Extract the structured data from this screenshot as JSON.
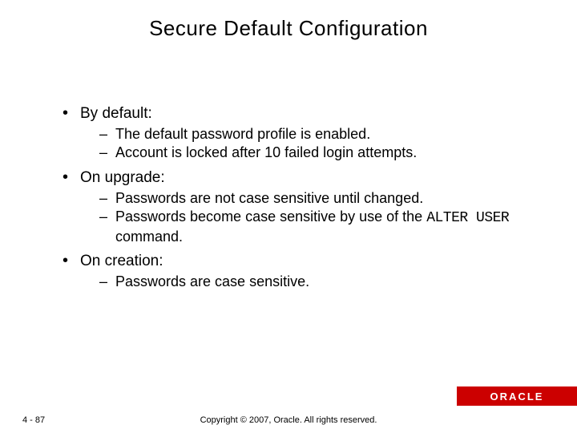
{
  "title": "Secure Default Configuration",
  "sections": [
    {
      "heading": "By default:",
      "items": [
        "The default password profile is enabled.",
        "Account is locked after 10 failed login attempts."
      ]
    },
    {
      "heading": "On upgrade:",
      "items": [
        "Passwords are not case sensitive until changed.",
        "Passwords become case sensitive by use of the "
      ],
      "code": "ALTER USER",
      "code_tail": " command."
    },
    {
      "heading": "On creation:",
      "items": [
        "Passwords are case sensitive."
      ]
    }
  ],
  "logo": "ORACLE",
  "pagenum": "4 - 87",
  "copyright": "Copyright © 2007, Oracle. All rights reserved."
}
